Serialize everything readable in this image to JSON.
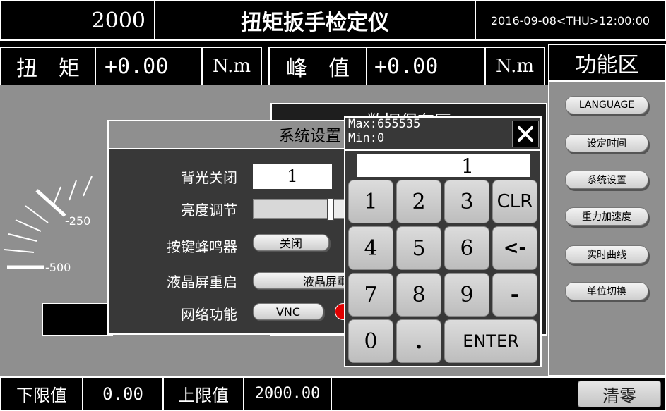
{
  "top_bar": {
    "left_value": "2000",
    "title": "扭矩扳手检定仪",
    "datetime": "2016-09-08<THU>12:00:00"
  },
  "readouts": {
    "torque_label": "扭　矩",
    "torque_value": "+0.00",
    "torque_unit": "N.m",
    "peak_label": "峰　值",
    "peak_value": "+0.00",
    "peak_unit": "N.m"
  },
  "function_panel": {
    "title": "功能区",
    "buttons": [
      "LANGUAGE",
      "设定时间",
      "系统设置",
      "重力加速度",
      "实时曲线",
      "单位切换"
    ]
  },
  "gauge": {
    "tick_labels": [
      "-250",
      "-500"
    ]
  },
  "data_save": {
    "title": "数据保存区"
  },
  "system_dialog": {
    "title": "系统设置",
    "backlight_label": "背光关闭",
    "backlight_value": "1",
    "brightness_label": "亮度调节",
    "brightness_level": 0.85,
    "buzzer_label": "按键蜂鸣器",
    "buzzer_button": "关闭",
    "lcd_restart_label": "液晶屏重启",
    "lcd_restart_button": "液晶屏重",
    "network_label": "网络功能",
    "network_button": "VNC",
    "status_color": "#e00000"
  },
  "keypad": {
    "max_text": "Max:655535",
    "min_text": "Min:0",
    "close_icon": "close-icon",
    "display_value": "1",
    "keys": [
      "1",
      "2",
      "3",
      "CLR",
      "4",
      "5",
      "6",
      "<-",
      "7",
      "8",
      "9",
      "-",
      "0",
      ".",
      "ENTER"
    ]
  },
  "bottom_bar": {
    "lower_label": "下限值",
    "lower_value": "0.00",
    "upper_label": "上限值",
    "upper_value": "2000.00",
    "clear_button": "清零"
  },
  "colors": {
    "panel_gray": "#8f8f8f",
    "dialog_dark": "#383838",
    "status_red": "#e00000"
  }
}
